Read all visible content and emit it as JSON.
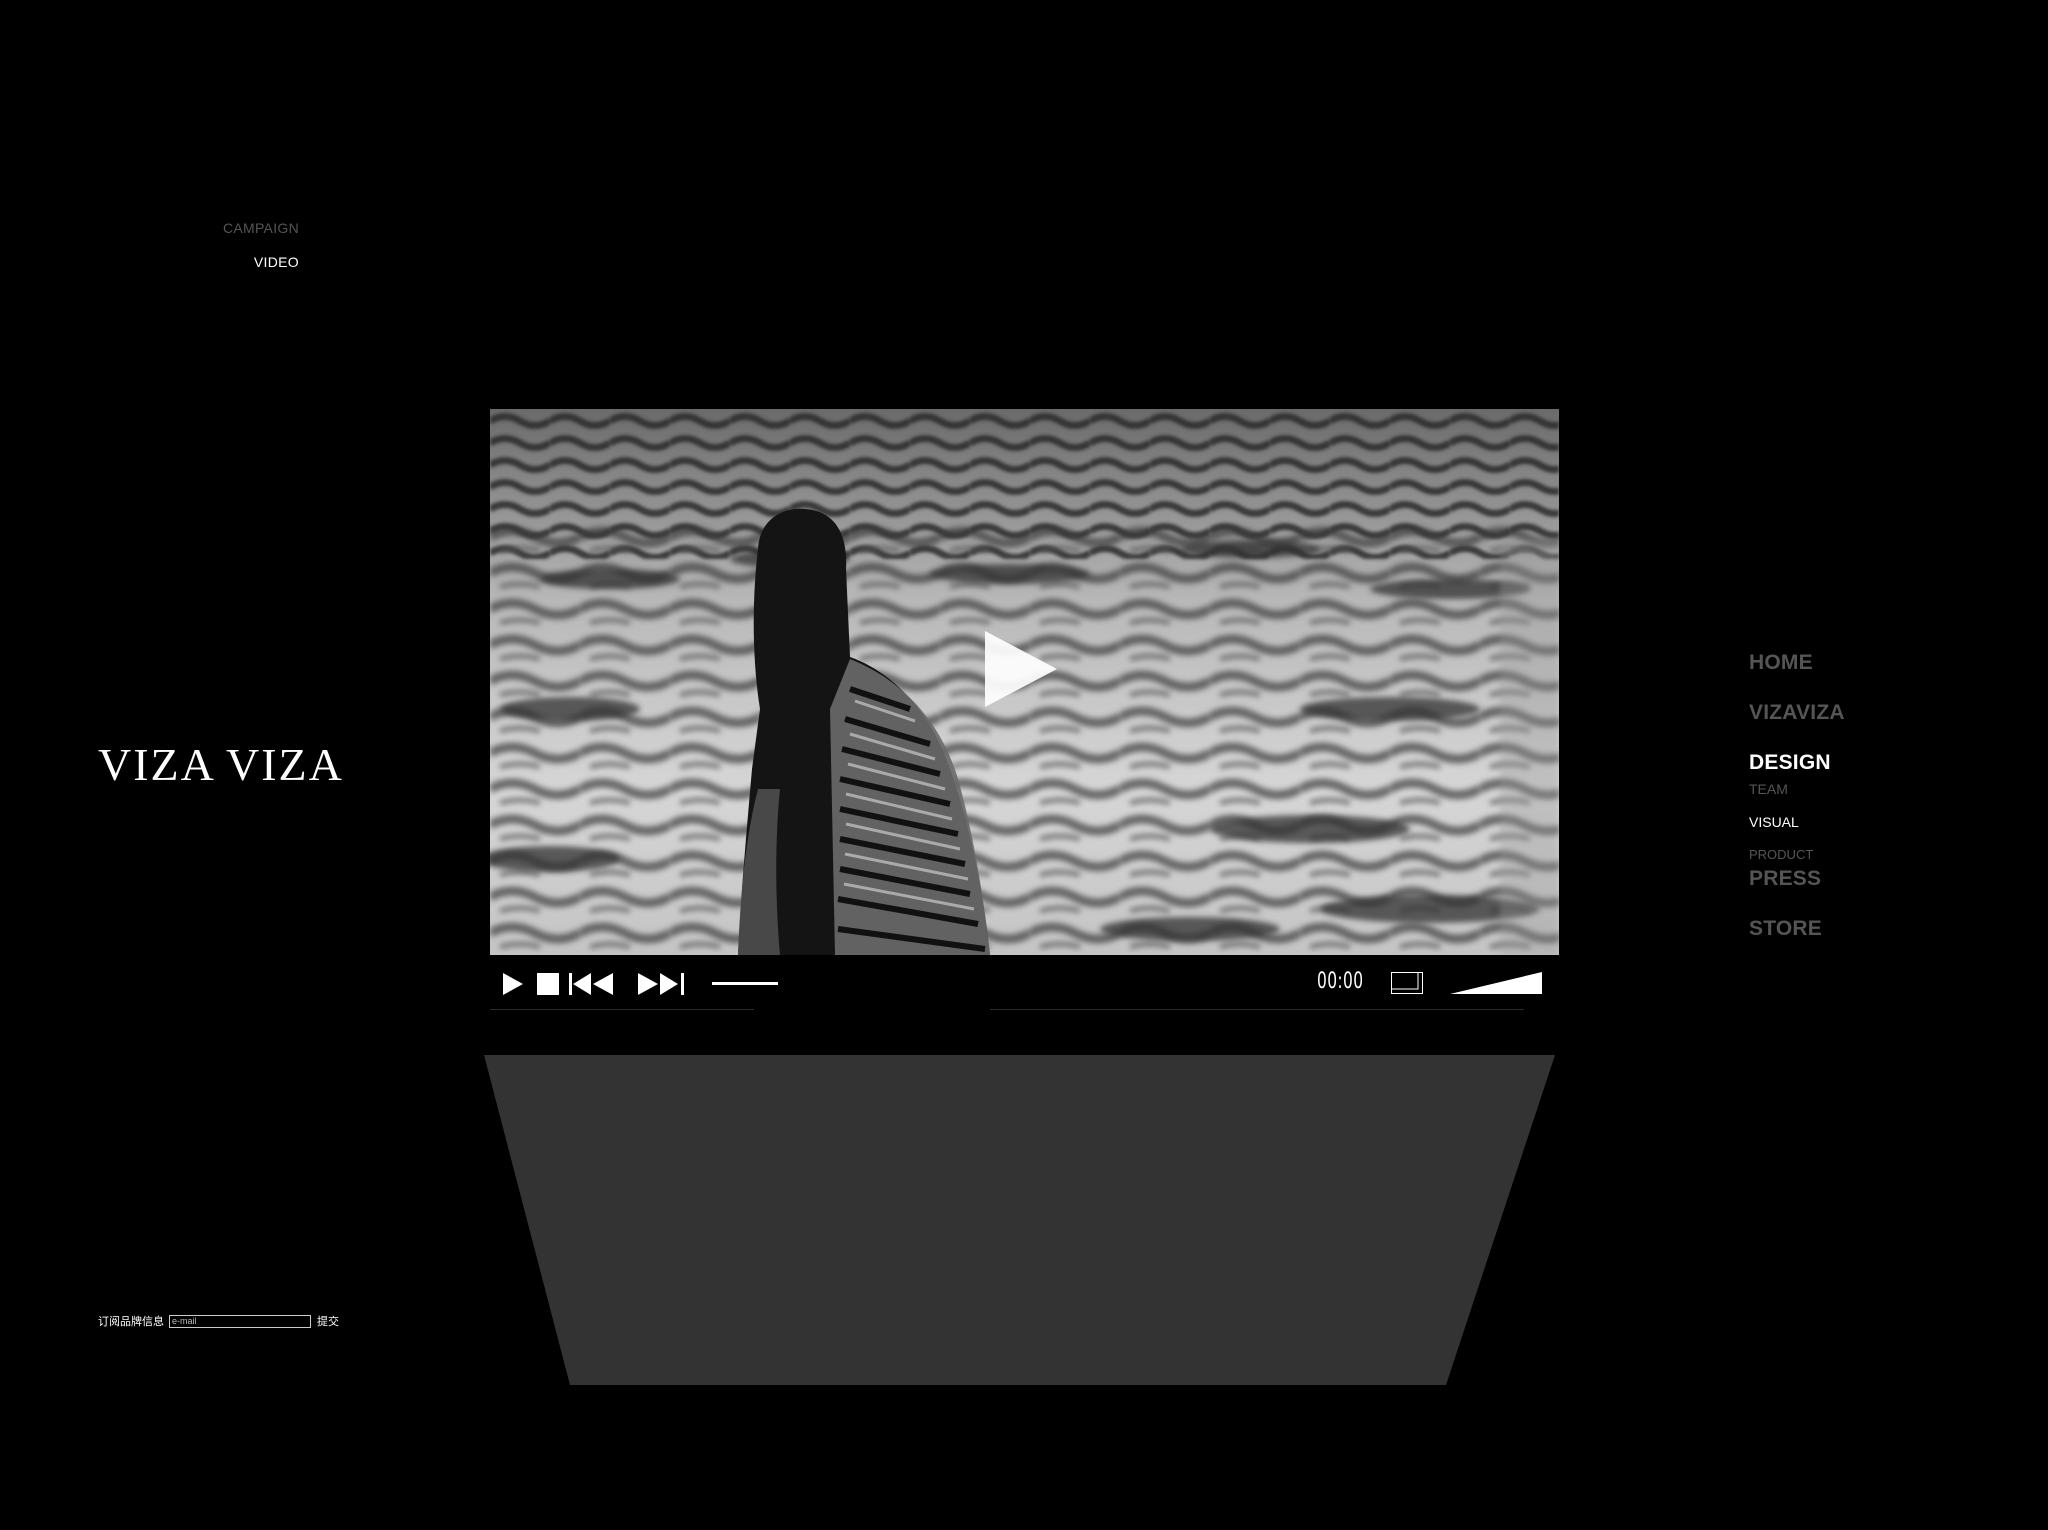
{
  "brand": {
    "logo_text": "VIZA VIZA"
  },
  "subnav": {
    "items": [
      {
        "label": "CAMPAIGN",
        "active": false
      },
      {
        "label": "VIDEO",
        "active": true
      }
    ]
  },
  "video": {
    "time": "00:00",
    "progress": 0.0,
    "volume": 1.0,
    "icons": [
      "play-icon",
      "stop-icon",
      "previous-icon",
      "next-icon",
      "fullscreen-icon",
      "volume-icon",
      "big-play-icon"
    ]
  },
  "mainnav": {
    "items": [
      {
        "label": "HOME"
      },
      {
        "label": "VIZAVIZA"
      },
      {
        "label": "DESIGN",
        "active": true,
        "children": [
          {
            "label": "TEAM",
            "active": false
          },
          {
            "label": "VISUAL",
            "active": true
          },
          {
            "label": "PRODUCT",
            "active": false
          }
        ]
      },
      {
        "label": "PRESS"
      },
      {
        "label": "STORE"
      }
    ]
  },
  "subscribe": {
    "label": "订阅品牌信息",
    "placeholder": "e-mail",
    "value": "",
    "submit_label": "提交"
  },
  "colors": {
    "background": "#000000",
    "active_text": "#ffffff",
    "inactive_text": "#555555",
    "reflection": "#333333"
  }
}
